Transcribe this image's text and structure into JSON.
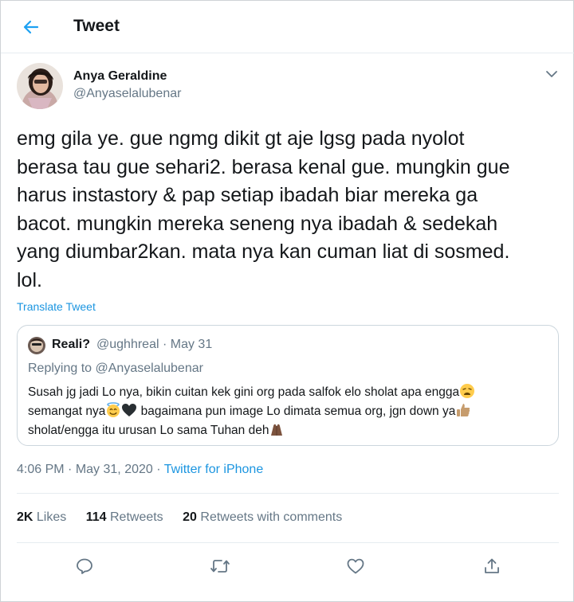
{
  "header": {
    "title": "Tweet",
    "back_icon": "arrow-left-icon"
  },
  "author": {
    "name": "Anya Geraldine",
    "handle": "@Anyaselalubenar"
  },
  "tweet": {
    "text": "emg gila ye. gue ngmg dikit gt aje lgsg pada nyolot\nberasa tau gue sehari2. berasa kenal gue. mungkin gue\nharus instastory & pap setiap ibadah biar mereka ga\nbacot. mungkin mereka seneng nya ibadah & sedekah\nyang diumbar2kan. mata nya kan cuman liat di sosmed.\nlol.",
    "translate_label": "Translate Tweet"
  },
  "quote": {
    "name": "Reali?",
    "handle": "@ughhreal",
    "separator": "·",
    "date": "May 31",
    "replying_prefix": "Replying to",
    "replying_to": "@Anyaselalubenar",
    "text_1": "Susah jg jadi Lo nya, bikin cuitan kek gini org pada salfok elo sholat apa engga",
    "text_2": "semangat nya",
    "text_3": " bagaimana pun image Lo dimata semua org, jgn down ya",
    "text_4": "sholat/engga itu urusan Lo sama Tuhan deh"
  },
  "meta": {
    "time": "4:06 PM",
    "separator": "·",
    "date": "May 31, 2020",
    "source": "Twitter for iPhone"
  },
  "stats": {
    "likes_count": "2K",
    "likes_label": "Likes",
    "retweets_count": "114",
    "retweets_label": "Retweets",
    "rwc_count": "20",
    "rwc_label": "Retweets with comments"
  },
  "colors": {
    "accent": "#1da1f2",
    "link": "#1b95e0",
    "muted": "#657786",
    "text": "#14171a"
  },
  "actions": [
    "reply-icon",
    "retweet-icon",
    "like-icon",
    "share-icon"
  ]
}
